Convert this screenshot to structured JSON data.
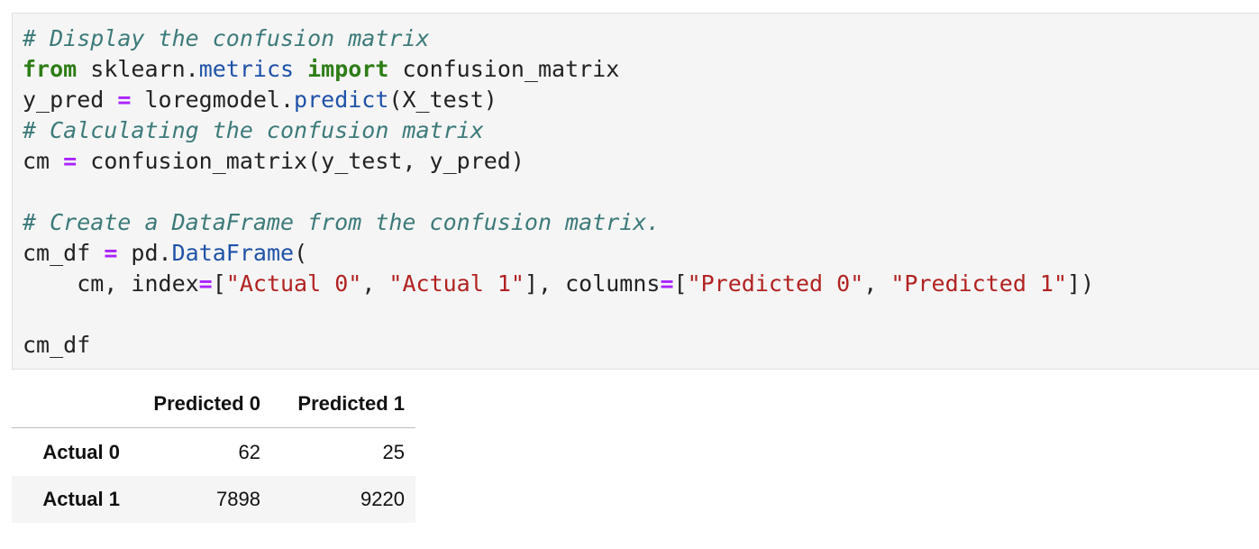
{
  "code_cell": {
    "lines": [
      [
        {
          "t": "comment",
          "v": "# Display the confusion matrix"
        }
      ],
      [
        {
          "t": "kw",
          "v": "from"
        },
        {
          "t": "plain",
          "v": " sklearn."
        },
        {
          "t": "attr",
          "v": "metrics"
        },
        {
          "t": "plain",
          "v": " "
        },
        {
          "t": "kw",
          "v": "import"
        },
        {
          "t": "plain",
          "v": " confusion_matrix"
        }
      ],
      [
        {
          "t": "plain",
          "v": "y_pred "
        },
        {
          "t": "op",
          "v": "="
        },
        {
          "t": "plain",
          "v": " loregmodel."
        },
        {
          "t": "attr",
          "v": "predict"
        },
        {
          "t": "plain",
          "v": "(X_test)"
        }
      ],
      [
        {
          "t": "comment",
          "v": "# Calculating the confusion matrix"
        }
      ],
      [
        {
          "t": "plain",
          "v": "cm "
        },
        {
          "t": "op",
          "v": "="
        },
        {
          "t": "plain",
          "v": " confusion_matrix(y_test, y_pred)"
        }
      ],
      [],
      [
        {
          "t": "comment",
          "v": "# Create a DataFrame from the confusion matrix."
        }
      ],
      [
        {
          "t": "plain",
          "v": "cm_df "
        },
        {
          "t": "op",
          "v": "="
        },
        {
          "t": "plain",
          "v": " pd."
        },
        {
          "t": "attr",
          "v": "DataFrame"
        },
        {
          "t": "plain",
          "v": "("
        }
      ],
      [
        {
          "t": "plain",
          "v": "    cm, index"
        },
        {
          "t": "op",
          "v": "="
        },
        {
          "t": "plain",
          "v": "["
        },
        {
          "t": "str",
          "v": "\"Actual 0\""
        },
        {
          "t": "plain",
          "v": ", "
        },
        {
          "t": "str",
          "v": "\"Actual 1\""
        },
        {
          "t": "plain",
          "v": "], columns"
        },
        {
          "t": "op",
          "v": "="
        },
        {
          "t": "plain",
          "v": "["
        },
        {
          "t": "str",
          "v": "\"Predicted 0\""
        },
        {
          "t": "plain",
          "v": ", "
        },
        {
          "t": "str",
          "v": "\"Predicted 1\""
        },
        {
          "t": "plain",
          "v": "])"
        }
      ],
      [],
      [
        {
          "t": "plain",
          "v": "cm_df"
        }
      ]
    ]
  },
  "output": {
    "columns": [
      "Predicted 0",
      "Predicted 1"
    ],
    "rows": [
      {
        "index": "Actual 0",
        "values": [
          "62",
          "25"
        ]
      },
      {
        "index": "Actual 1",
        "values": [
          "7898",
          "9220"
        ]
      }
    ]
  }
}
